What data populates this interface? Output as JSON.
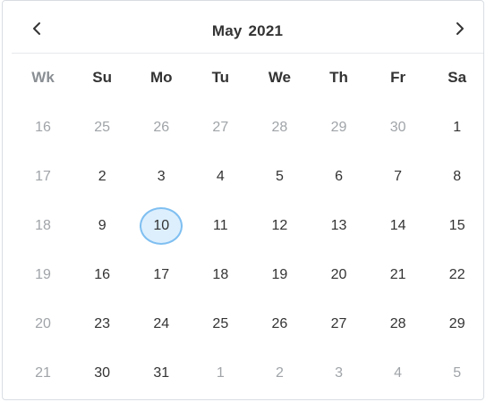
{
  "header": {
    "month": "May",
    "year": "2021",
    "prev_icon": "chevron-left-icon",
    "next_icon": "chevron-right-icon"
  },
  "weekday_headers": [
    "Wk",
    "Su",
    "Mo",
    "Tu",
    "We",
    "Th",
    "Fr",
    "Sa"
  ],
  "weeks": [
    {
      "week": "16",
      "days": [
        {
          "d": "25",
          "other": true
        },
        {
          "d": "26",
          "other": true
        },
        {
          "d": "27",
          "other": true
        },
        {
          "d": "28",
          "other": true
        },
        {
          "d": "29",
          "other": true
        },
        {
          "d": "30",
          "other": true
        },
        {
          "d": "1",
          "other": false
        }
      ]
    },
    {
      "week": "17",
      "days": [
        {
          "d": "2",
          "other": false
        },
        {
          "d": "3",
          "other": false
        },
        {
          "d": "4",
          "other": false
        },
        {
          "d": "5",
          "other": false
        },
        {
          "d": "6",
          "other": false
        },
        {
          "d": "7",
          "other": false
        },
        {
          "d": "8",
          "other": false
        }
      ]
    },
    {
      "week": "18",
      "days": [
        {
          "d": "9",
          "other": false
        },
        {
          "d": "10",
          "other": false,
          "selected": true
        },
        {
          "d": "11",
          "other": false
        },
        {
          "d": "12",
          "other": false
        },
        {
          "d": "13",
          "other": false
        },
        {
          "d": "14",
          "other": false
        },
        {
          "d": "15",
          "other": false
        }
      ]
    },
    {
      "week": "19",
      "days": [
        {
          "d": "16",
          "other": false
        },
        {
          "d": "17",
          "other": false
        },
        {
          "d": "18",
          "other": false
        },
        {
          "d": "19",
          "other": false
        },
        {
          "d": "20",
          "other": false
        },
        {
          "d": "21",
          "other": false
        },
        {
          "d": "22",
          "other": false
        }
      ]
    },
    {
      "week": "20",
      "days": [
        {
          "d": "23",
          "other": false
        },
        {
          "d": "24",
          "other": false
        },
        {
          "d": "25",
          "other": false
        },
        {
          "d": "26",
          "other": false
        },
        {
          "d": "27",
          "other": false
        },
        {
          "d": "28",
          "other": false
        },
        {
          "d": "29",
          "other": false
        }
      ]
    },
    {
      "week": "21",
      "days": [
        {
          "d": "30",
          "other": false
        },
        {
          "d": "31",
          "other": false
        },
        {
          "d": "1",
          "other": true
        },
        {
          "d": "2",
          "other": true
        },
        {
          "d": "3",
          "other": true
        },
        {
          "d": "4",
          "other": true
        },
        {
          "d": "5",
          "other": true
        }
      ]
    }
  ],
  "colors": {
    "selected_fill": "#ddeffd",
    "selected_ring": "#7fbff1",
    "muted_text": "#a0a4a8",
    "text": "#333333"
  }
}
